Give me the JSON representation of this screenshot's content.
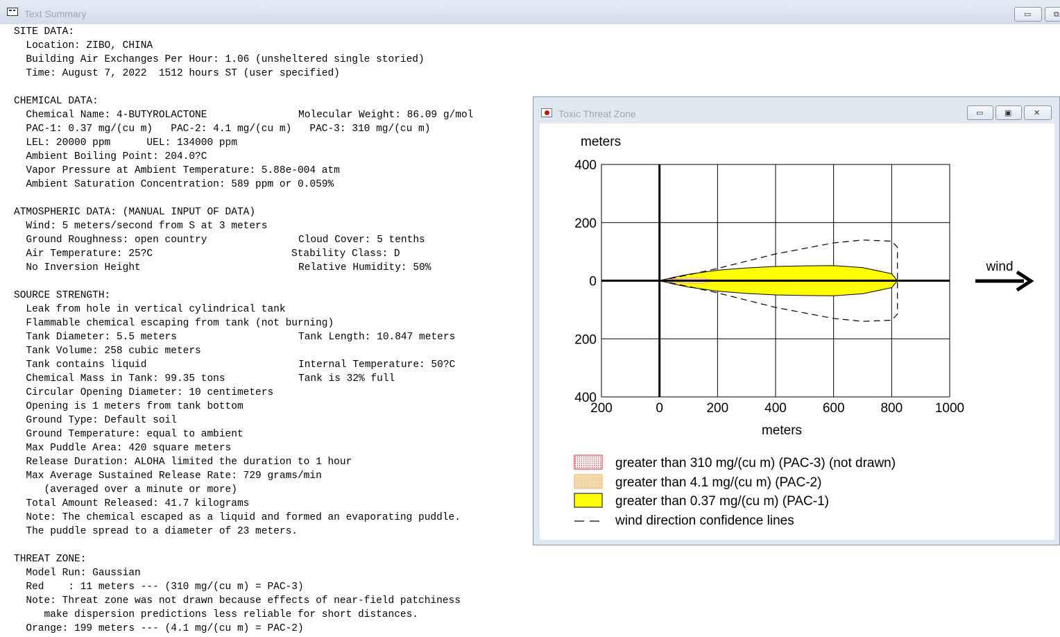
{
  "text_summary": {
    "title": "Text Summary",
    "sections": [
      {
        "id": "site",
        "lines": [
          {
            "t": "SITE DATA:"
          },
          {
            "t": "  Location: ZIBO, CHINA"
          },
          {
            "t": "  Building Air Exchanges Per Hour: 1.06 (unsheltered single storied)"
          },
          {
            "t": "  Time: August 7, 2022  1512 hours ST (user specified)"
          }
        ]
      },
      {
        "id": "chemical",
        "lines": [
          {
            "t": "CHEMICAL DATA:"
          },
          {
            "t": "  Chemical Name: 4-BUTYROLACTONE",
            "c2": "Molecular Weight: 86.09 g/mol"
          },
          {
            "t": "  PAC-1: 0.37 mg/(cu m)   PAC-2: 4.1 mg/(cu m)   PAC-3: 310 mg/(cu m)"
          },
          {
            "t": "  LEL: 20000 ppm      UEL: 134000 ppm"
          },
          {
            "t": "  Ambient Boiling Point: 204.0?C"
          },
          {
            "t": "  Vapor Pressure at Ambient Temperature: 5.88e-004 atm"
          },
          {
            "t": "  Ambient Saturation Concentration: 589 ppm or 0.059%"
          }
        ]
      },
      {
        "id": "atmospheric",
        "lines": [
          {
            "t": "ATMOSPHERIC DATA: (MANUAL INPUT OF DATA)"
          },
          {
            "t": "  Wind: 5 meters/second from S at 3 meters"
          },
          {
            "t": "  Ground Roughness: open country",
            "c2": "Cloud Cover: 5 tenths"
          },
          {
            "t": "  Air Temperature: 25?C",
            "c2": "Stability Class: D",
            "c2x": "b"
          },
          {
            "t": "  No Inversion Height",
            "c2": "Relative Humidity: 50%"
          }
        ]
      },
      {
        "id": "source",
        "lines": [
          {
            "t": "SOURCE STRENGTH:"
          },
          {
            "t": "  Leak from hole in vertical cylindrical tank"
          },
          {
            "t": "  Flammable chemical escaping from tank (not burning)"
          },
          {
            "t": "  Tank Diameter: 5.5 meters",
            "c2": "Tank Length: 10.847 meters"
          },
          {
            "t": "  Tank Volume: 258 cubic meters"
          },
          {
            "t": "  Tank contains liquid",
            "c2": "Internal Temperature: 50?C"
          },
          {
            "t": "  Chemical Mass in Tank: 99.35 tons",
            "c2": "Tank is 32% full"
          },
          {
            "t": "  Circular Opening Diameter: 10 centimeters"
          },
          {
            "t": "  Opening is 1 meters from tank bottom"
          },
          {
            "t": "  Ground Type: Default soil"
          },
          {
            "t": "  Ground Temperature: equal to ambient"
          },
          {
            "t": "  Max Puddle Area: 420 square meters"
          },
          {
            "t": "  Release Duration: ALOHA limited the duration to 1 hour"
          },
          {
            "t": "  Max Average Sustained Release Rate: 729 grams/min"
          },
          {
            "t": "     (averaged over a minute or more)"
          },
          {
            "t": "  Total Amount Released: 41.7 kilograms"
          },
          {
            "t": "  Note: The chemical escaped as a liquid and formed an evaporating puddle."
          },
          {
            "t": "  The puddle spread to a diameter of 23 meters."
          }
        ]
      },
      {
        "id": "threat",
        "lines": [
          {
            "t": "THREAT ZONE:"
          },
          {
            "t": "  Model Run: Gaussian"
          },
          {
            "t": "  Red    : 11 meters --- (310 mg/(cu m) = PAC-3)"
          },
          {
            "t": "  Note: Threat zone was not drawn because effects of near-field patchiness"
          },
          {
            "t": "     make dispersion predictions less reliable for short distances."
          },
          {
            "t": "  Orange: 199 meters --- (4.1 mg/(cu m) = PAC-2)"
          }
        ]
      }
    ]
  },
  "threat_zone": {
    "title": "Toxic Threat Zone",
    "y_unit_label": "meters",
    "x_axis_label": "meters",
    "wind_label": "wind",
    "x_ticks": [
      "200",
      "0",
      "200",
      "400",
      "600",
      "800",
      "1000"
    ],
    "x_tick_values": [
      -200,
      0,
      200,
      400,
      600,
      800,
      1000
    ],
    "y_ticks": [
      "400",
      "200",
      "0",
      "200",
      "400"
    ],
    "y_tick_values": [
      400,
      200,
      0,
      -200,
      -400
    ],
    "legend": [
      {
        "label": "greater than 310 mg/(cu m) (PAC-3) (not drawn)",
        "swatch": "pac3"
      },
      {
        "label": "greater than 4.1 mg/(cu m) (PAC-2)",
        "swatch": "pac2"
      },
      {
        "label": "greater than 0.37 mg/(cu m) (PAC-1)",
        "swatch": "pac1"
      },
      {
        "label": "wind direction confidence lines",
        "swatch": "dash"
      }
    ],
    "colors": {
      "pac1": "#ffff00",
      "pac2": "#f5b066",
      "pac3": "#e02020",
      "grid": "#000000"
    }
  },
  "chart_data": {
    "type": "area",
    "x_range": [
      -200,
      1000
    ],
    "y_range": [
      -400,
      400
    ],
    "x_unit": "meters",
    "y_unit": "meters",
    "grid": true,
    "zones": [
      {
        "name": "PAC-1",
        "concentration": "0.37 mg/(cu m)",
        "downwind_extent": 820,
        "max_halfwidth": 52,
        "profile": [
          [
            0,
            0
          ],
          [
            50,
            12
          ],
          [
            100,
            22
          ],
          [
            200,
            36
          ],
          [
            300,
            44
          ],
          [
            400,
            49
          ],
          [
            500,
            51
          ],
          [
            600,
            52
          ],
          [
            700,
            45
          ],
          [
            800,
            24
          ],
          [
            820,
            0
          ]
        ]
      },
      {
        "name": "PAC-2",
        "concentration": "4.1 mg/(cu m)",
        "downwind_extent": 199,
        "max_halfwidth": 10,
        "profile": [
          [
            0,
            0
          ],
          [
            40,
            6
          ],
          [
            100,
            9
          ],
          [
            150,
            9
          ],
          [
            199,
            0
          ]
        ]
      },
      {
        "name": "Wind direction confidence lines",
        "upper": [
          [
            0,
            0
          ],
          [
            100,
            20
          ],
          [
            200,
            42
          ],
          [
            400,
            92
          ],
          [
            600,
            130
          ],
          [
            700,
            140
          ],
          [
            800,
            136
          ],
          [
            820,
            115
          ],
          [
            820,
            0
          ]
        ],
        "lower": [
          [
            0,
            0
          ],
          [
            100,
            -20
          ],
          [
            200,
            -42
          ],
          [
            400,
            -92
          ],
          [
            600,
            -130
          ],
          [
            700,
            -140
          ],
          [
            800,
            -136
          ],
          [
            820,
            -115
          ],
          [
            820,
            0
          ]
        ]
      }
    ]
  }
}
